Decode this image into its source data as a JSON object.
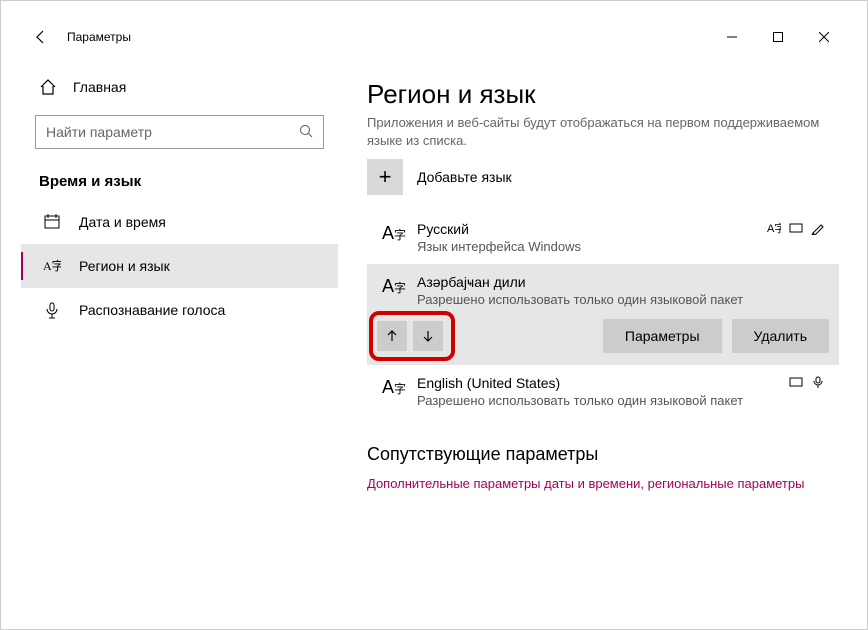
{
  "titlebar": {
    "title": "Параметры"
  },
  "sidebar": {
    "home": "Главная",
    "search_placeholder": "Найти параметр",
    "category": "Время и язык",
    "items": [
      {
        "label": "Дата и время",
        "icon": "datetime"
      },
      {
        "label": "Регион и язык",
        "icon": "region"
      },
      {
        "label": "Распознавание голоса",
        "icon": "voice"
      }
    ]
  },
  "main": {
    "title": "Регион и язык",
    "hint": "Приложения и веб-сайты будут отображаться на первом поддерживаемом языке из списка.",
    "add_label": "Добавьте язык",
    "langs": [
      {
        "name": "Русский",
        "sub": "Язык интерфейса Windows"
      },
      {
        "name": "Азәрбајҹан дили",
        "sub": "Разрешено использовать только один языковой пакет"
      },
      {
        "name": "English (United States)",
        "sub": "Разрешено использовать только один языковой пакет"
      }
    ],
    "options_btn": "Параметры",
    "remove_btn": "Удалить",
    "related_header": "Сопутствующие параметры",
    "related_link": "Дополнительные параметры даты и времени, региональные параметры"
  }
}
